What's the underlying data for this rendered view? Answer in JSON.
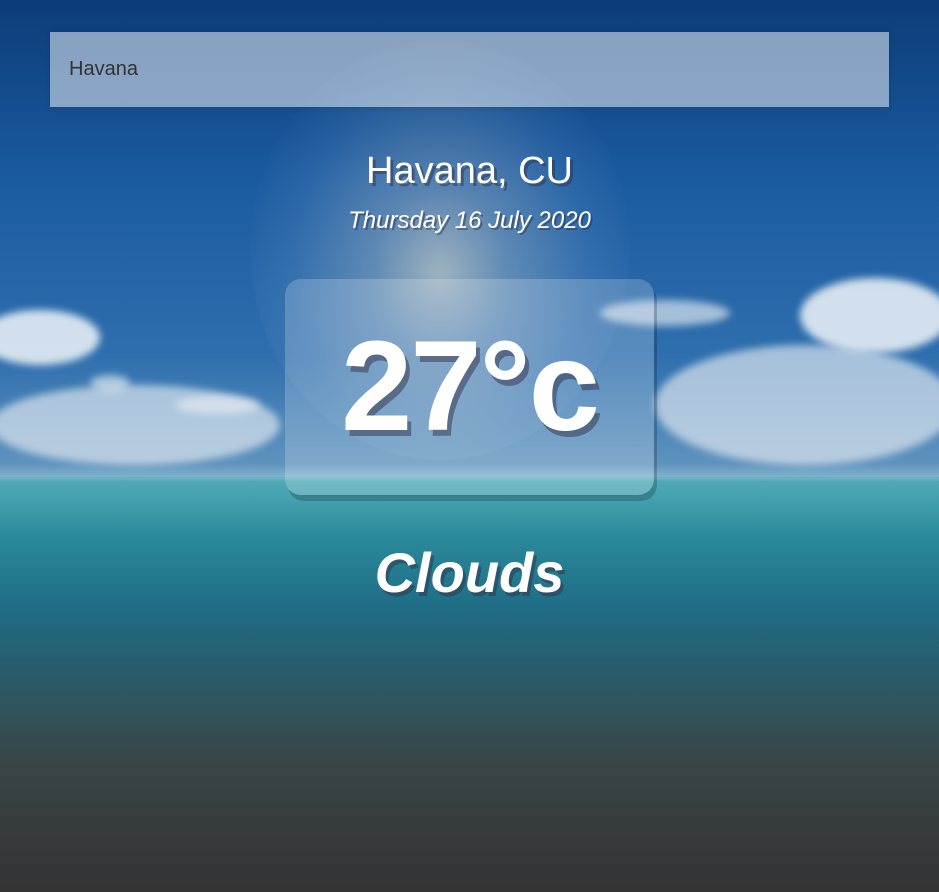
{
  "search": {
    "value": "Havana"
  },
  "location": "Havana, CU",
  "date": "Thursday 16 July 2020",
  "temperature": "27°c",
  "condition": "Clouds",
  "colors": {
    "text": "#ffffff",
    "search_text": "#333333"
  }
}
